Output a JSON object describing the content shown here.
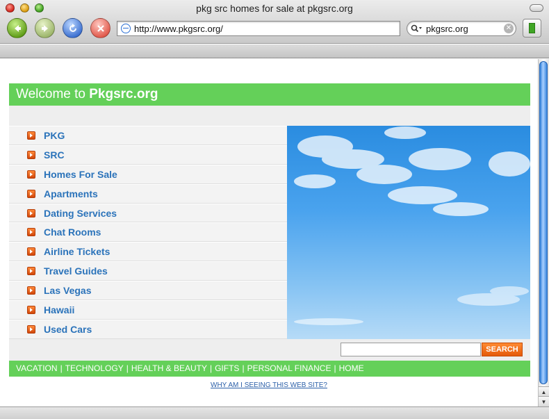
{
  "window": {
    "title": "pkg src homes for sale at pkgsrc.org"
  },
  "toolbar": {
    "url": "http://www.pkgsrc.org/",
    "search_value": "pkgsrc.org",
    "icons": [
      "back-arrow",
      "forward-arrow",
      "reload",
      "stop",
      "globe",
      "magnifier",
      "clear",
      "bookmark"
    ]
  },
  "page": {
    "welcome_prefix": "Welcome to ",
    "welcome_site": "Pkgsrc.org",
    "links": [
      "PKG",
      "SRC",
      "Homes For Sale",
      "Apartments",
      "Dating Services",
      "Chat Rooms",
      "Airline Tickets",
      "Travel Guides",
      "Las Vegas",
      "Hawaii",
      "Used Cars"
    ],
    "search_button": "SEARCH",
    "bottom_nav": [
      "VACATION",
      "TECHNOLOGY",
      "HEALTH & BEAUTY",
      "GIFTS",
      "PERSONAL FINANCE",
      "HOME"
    ],
    "why_link": "WHY AM I SEEING THIS WEB SITE?"
  },
  "colors": {
    "banner_green": "#64d059",
    "link_blue": "#2b73ba",
    "search_orange": "#e55a0a"
  }
}
